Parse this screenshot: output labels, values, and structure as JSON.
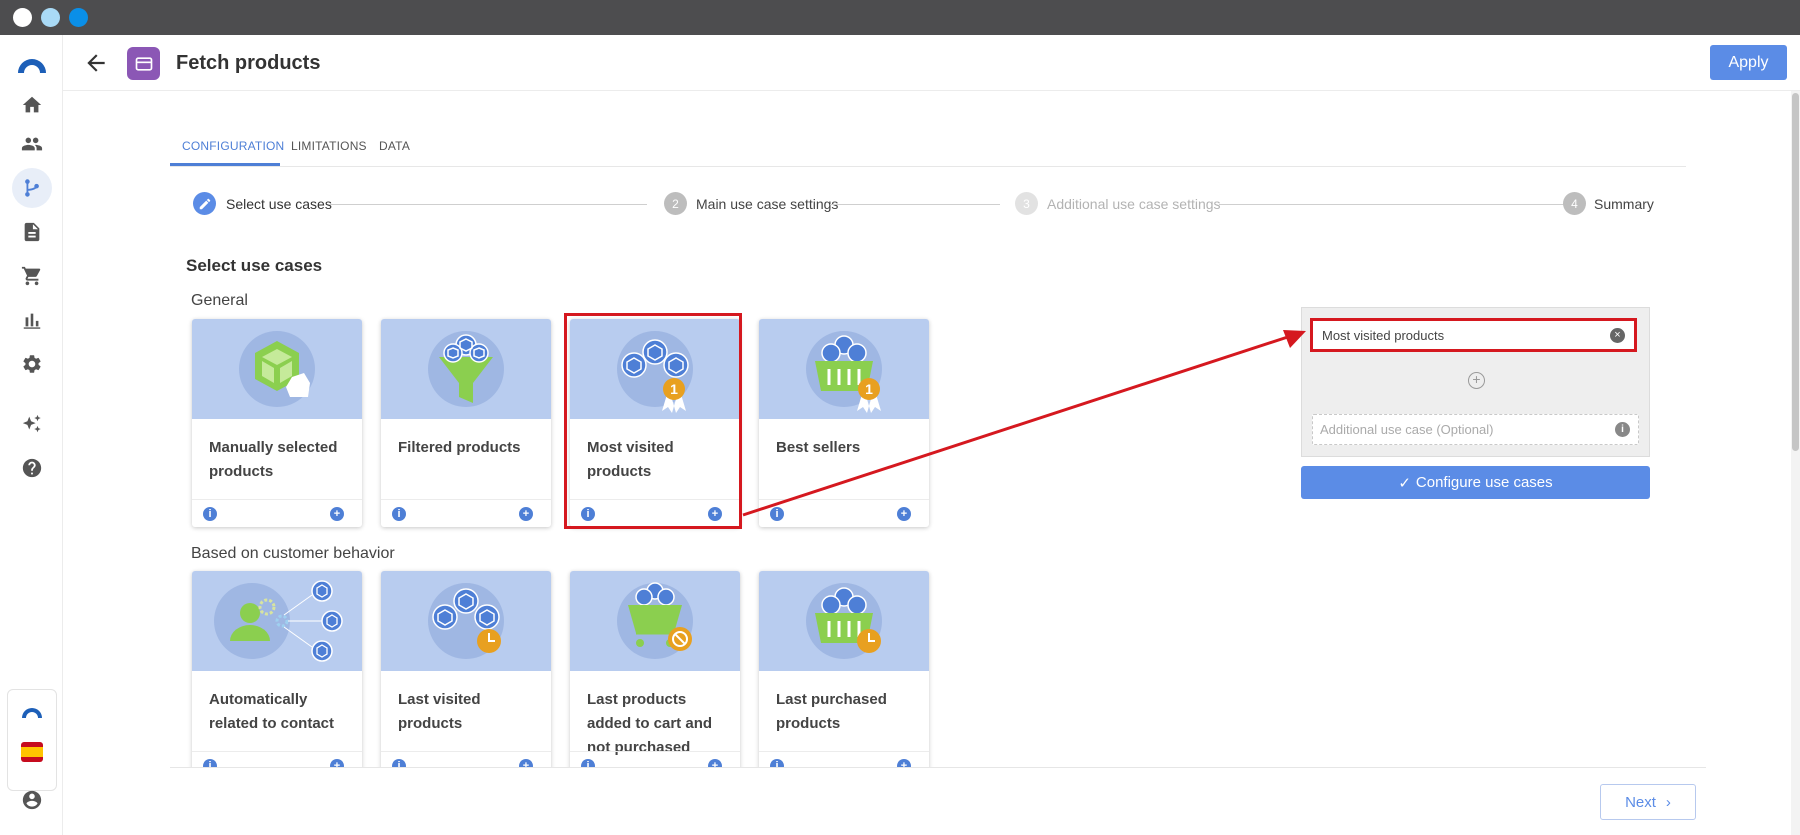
{
  "window": {
    "dots": [
      "#ffffff",
      "#a9daf6",
      "#0a8fe8"
    ]
  },
  "header": {
    "title": "Fetch products",
    "apply_label": "Apply"
  },
  "tabs": [
    {
      "label": "CONFIGURATION",
      "active": true
    },
    {
      "label": "LIMITATIONS",
      "active": false
    },
    {
      "label": "DATA",
      "active": false
    }
  ],
  "stepper": [
    {
      "num": "",
      "label": "Select use cases",
      "state": "active"
    },
    {
      "num": "2",
      "label": "Main use case settings",
      "state": "normal"
    },
    {
      "num": "3",
      "label": "Additional use case settings",
      "state": "disabled"
    },
    {
      "num": "4",
      "label": "Summary",
      "state": "normal"
    }
  ],
  "section": {
    "title": "Select use cases",
    "groups": [
      {
        "label": "General",
        "cards": [
          {
            "label": "Manually selected products",
            "icon": "hand-cube-icon"
          },
          {
            "label": "Filtered products",
            "icon": "funnel-cubes-icon"
          },
          {
            "label": "Most visited products",
            "icon": "cubes-medal-icon",
            "highlighted": true
          },
          {
            "label": "Best sellers",
            "icon": "basket-medal-icon"
          }
        ]
      },
      {
        "label": "Based on customer behavior",
        "cards": [
          {
            "label": "Automatically related to contact",
            "icon": "contact-cubes-icon"
          },
          {
            "label": "Last visited products",
            "icon": "cubes-clock-icon"
          },
          {
            "label": "Last products added to cart and not purchased",
            "icon": "cart-blocked-icon"
          },
          {
            "label": "Last purchased products",
            "icon": "basket-clock-icon"
          }
        ]
      }
    ]
  },
  "panel": {
    "selected": "Most visited products",
    "optional_placeholder": "Additional use case (Optional)",
    "configure_label": "Configure use cases"
  },
  "footer": {
    "next_label": "Next"
  },
  "colors": {
    "accent": "#5b8ce6",
    "highlight": "#d5181f",
    "app_icon": "#8b57b5"
  }
}
